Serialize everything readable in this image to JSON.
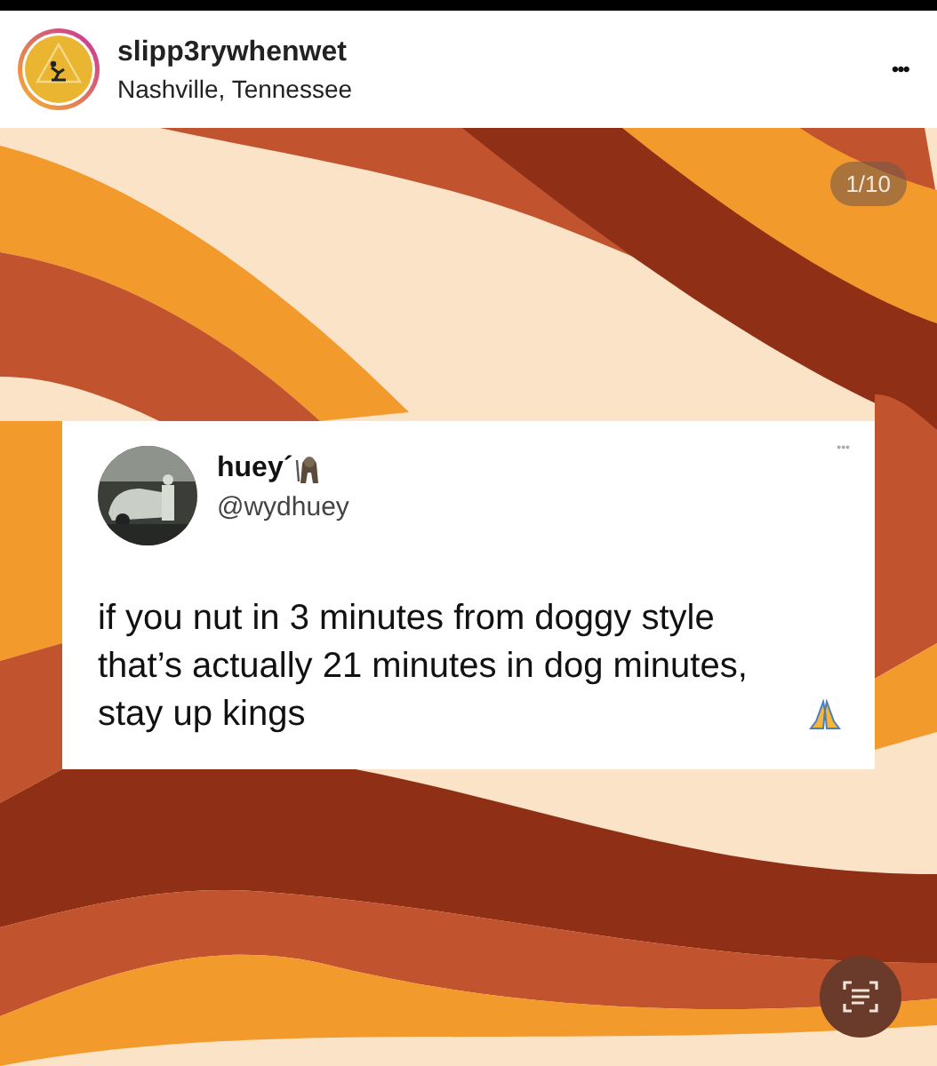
{
  "post_header": {
    "username": "slipp3rywhenwet",
    "location": "Nashville, Tennessee",
    "more": "•••"
  },
  "post": {
    "counter": "1/10",
    "tweet": {
      "name": "huey´",
      "handle": "@wydhuey",
      "more": "•••",
      "text": "if you nut in 3 minutes from doggy style that’s actually 21 minutes in dog minutes, stay up kings"
    }
  }
}
